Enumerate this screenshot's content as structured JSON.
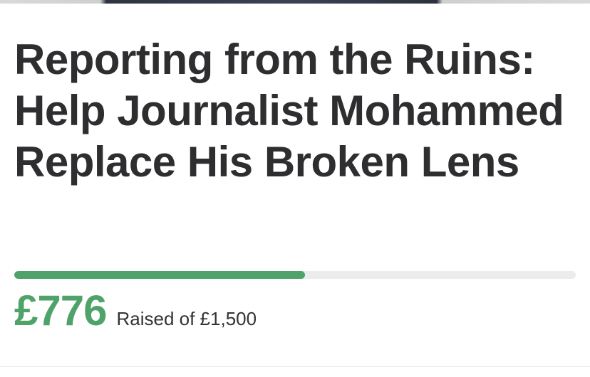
{
  "campaign": {
    "title": "Reporting from the Ruins: Help Journalist Mohammed Replace His Broken Lens",
    "progress_fraction": 0.5173,
    "raised_amount": "£776",
    "raised_label": "Raised of £1,500"
  },
  "colors": {
    "accent": "#4fa36a",
    "track": "#ececec",
    "title": "#2e2e30"
  }
}
